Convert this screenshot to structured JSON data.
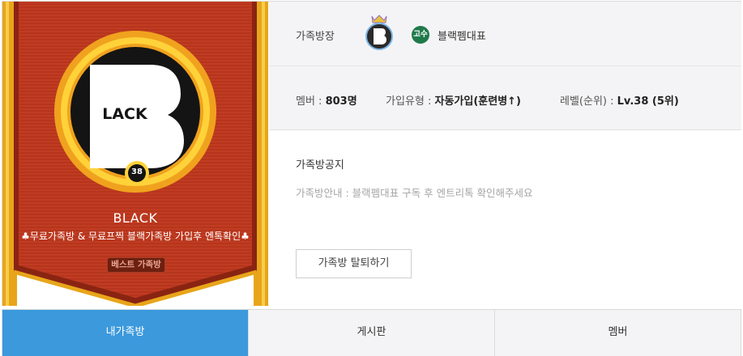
{
  "clan": {
    "name": "BLACK",
    "description": "♣무료가족방 & 무료프찍 블랙가족방 가입후 엔톡확인♣",
    "best_badge": "베스트 가족방",
    "emblem_letter": "B",
    "emblem_text": "LACK",
    "emblem_level": "38"
  },
  "leader": {
    "label": "가족방장",
    "rank_badge": "고수",
    "name": "블랙펨대표"
  },
  "stats": {
    "members_label": "멤버 :",
    "members_value": "803명",
    "join_label": "가입유형 :",
    "join_value": "자동가입(훈련병↑)",
    "level_label": "레벨(순위) :",
    "level_value": "Lv.38 (5위)"
  },
  "notice": {
    "title": "가족방공지",
    "text": "가족방안내 : 블랙펨대표 구독 후 엔트리톡 확인해주세요",
    "leave_button": "가족방 탈퇴하기"
  },
  "tabs": [
    {
      "label": "내가족방",
      "active": true
    },
    {
      "label": "게시판",
      "active": false
    },
    {
      "label": "멤버",
      "active": false
    }
  ],
  "colors": {
    "banner_red": "#b6351c",
    "gold": "#f2b424",
    "tab_active": "#3b99dc",
    "rank_green": "#1f7a4a"
  }
}
